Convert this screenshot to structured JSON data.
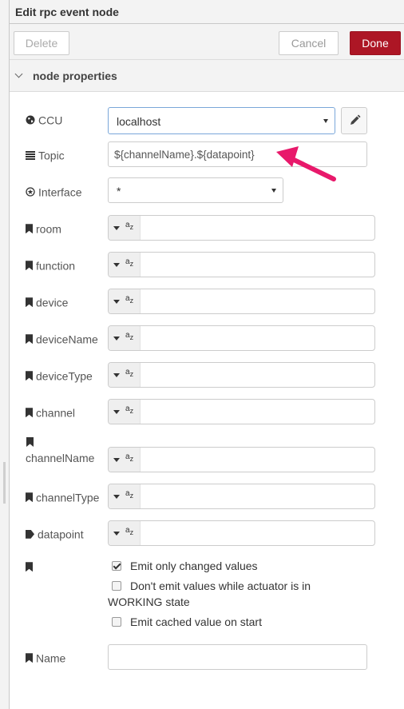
{
  "dialog": {
    "title": "Edit rpc event node",
    "delete_label": "Delete",
    "cancel_label": "Cancel",
    "done_label": "Done",
    "section_title": "node properties"
  },
  "fields": {
    "ccu": {
      "label": "CCU",
      "value": "localhost"
    },
    "topic": {
      "label": "Topic",
      "value": "${channelName}.${datapoint}"
    },
    "interface": {
      "label": "Interface",
      "value": "*"
    },
    "room": {
      "label": "room",
      "value": ""
    },
    "function": {
      "label": "function",
      "value": ""
    },
    "device": {
      "label": "device",
      "value": ""
    },
    "deviceName": {
      "label": "deviceName",
      "value": ""
    },
    "deviceType": {
      "label": "deviceType",
      "value": ""
    },
    "channel": {
      "label": "channel",
      "value": ""
    },
    "channelName": {
      "label": "channelName",
      "value": ""
    },
    "channelType": {
      "label": "channelType",
      "value": ""
    },
    "datapoint": {
      "label": "datapoint",
      "value": ""
    },
    "name": {
      "label": "Name",
      "value": ""
    }
  },
  "typed_input_type": {
    "a": "a",
    "z": "z"
  },
  "options": {
    "emit_changed": {
      "label": "Emit only changed values",
      "checked": true
    },
    "dont_emit_working": {
      "label_line1": "Don't emit values while actuator is in",
      "label_line2": "WORKING state",
      "checked": false
    },
    "emit_cached": {
      "label": "Emit cached value on start",
      "checked": false
    }
  },
  "colors": {
    "done_button": "#ad1625",
    "annotation_arrow": "#e8196b"
  },
  "icons": [
    "globe-icon",
    "list-icon",
    "cog-star-icon",
    "bookmark-icon",
    "tag-icon",
    "pencil-icon",
    "caret-down-icon"
  ]
}
